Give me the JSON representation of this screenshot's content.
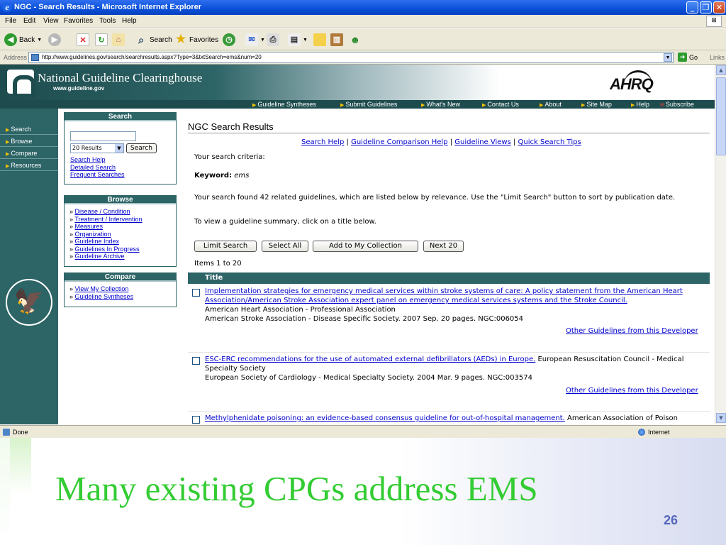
{
  "window": {
    "title": "NGC - Search Results - Microsoft Internet Explorer"
  },
  "menu": [
    "File",
    "Edit",
    "View",
    "Favorites",
    "Tools",
    "Help"
  ],
  "toolbar": {
    "back": "Back",
    "search": "Search",
    "favorites": "Favorites"
  },
  "address": {
    "label": "Address",
    "url": "http://www.guidelines.gov/search/searchresults.aspx?Type=3&txtSearch=ems&num=20",
    "go": "Go",
    "links": "Links"
  },
  "status": {
    "left": "Done",
    "right": "Internet"
  },
  "site": {
    "name": "National Guideline Clearinghouse",
    "url": "www.guideline.gov",
    "logo_right": "AHRQ",
    "nav": [
      "Guideline Syntheses",
      "Submit Guidelines",
      "What's New",
      "Contact Us",
      "About",
      "Site Map",
      "Help",
      "Subscribe"
    ],
    "leftnav": [
      "Search",
      "Browse",
      "Compare",
      "Resources"
    ]
  },
  "search_box": {
    "title": "Search",
    "input_value": "",
    "results_select": "20 Results",
    "button": "Search",
    "links": [
      "Search Help",
      "Detailed Search",
      "Frequent Searches"
    ]
  },
  "browse_box": {
    "title": "Browse",
    "links": [
      "Disease / Condition",
      "Treatment / Intervention",
      "Measures",
      "Organization",
      "Guideline Index",
      "Guidelines In Progress",
      "Guideline Archive"
    ]
  },
  "compare_box": {
    "title": "Compare",
    "links": [
      "View My Collection",
      "Guideline Syntheses"
    ]
  },
  "main": {
    "title": "NGC Search Results",
    "help_links": [
      "Search Help",
      "Guideline Comparison Help",
      "Guideline Views",
      "Quick Search Tips"
    ],
    "criteria_label": "Your search criteria:",
    "keyword_label": "Keyword:",
    "keyword_value": "ems",
    "found_text": "Your search found 42 related guidelines, which are listed below by relevance. Use the \"Limit Search\" button to sort by publication date.",
    "view_text": "To view a guideline summary, click on a title below.",
    "buttons": [
      "Limit Search",
      "Select All",
      "Add to My Collection",
      "Next 20"
    ],
    "items_text": "Items 1 to 20",
    "table_header": "Title",
    "other_link": "Other Guidelines from this Developer",
    "results": [
      {
        "title": "Implementation strategies for emergency medical services within stroke systems of care: A policy statement from the American Heart Association/American Stroke Association expert panel on emergency medical services systems and the Stroke Council.",
        "line1": "American Heart Association - Professional Association",
        "line2": "American Stroke Association - Disease Specific Society.  2007 Sep.  20 pages.  NGC:006054"
      },
      {
        "title": "ESC-ERC recommendations for the use of automated external defibrillators (AEDs) in Europe.",
        "tail": " European Resuscitation Council - Medical Specialty Society",
        "line2": "European Society of Cardiology - Medical Specialty Society.  2004 Mar.  9 pages.  NGC:003574"
      },
      {
        "title": "Methylphenidate poisoning: an evidence-based consensus guideline for out-of-hospital management.",
        "tail": " American Association of Poison"
      }
    ]
  },
  "slide": {
    "title": "Many existing CPGs address EMS",
    "number": "26"
  }
}
